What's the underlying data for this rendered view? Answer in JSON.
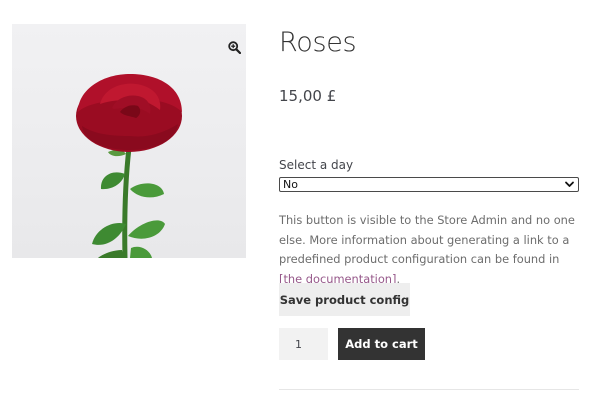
{
  "product": {
    "title": "Roses",
    "price": "15,00 £",
    "image_alt": "red rose"
  },
  "gallery": {
    "zoom_icon": "magnifier-plus-icon"
  },
  "day_select": {
    "label": "Select a day",
    "selected": "No"
  },
  "admin_notice": {
    "text_before": "This button is visible to the Store Admin and no one else. More information about generating a link to a predefined product configuration can be found in ",
    "link_text": "[the documentation]",
    "text_after": "."
  },
  "actions": {
    "save_config_label": "Save product config",
    "quantity": "1",
    "add_to_cart_label": "Add to cart"
  },
  "colors": {
    "button_dark": "#333333",
    "button_light": "#eeeeee",
    "link": "#96588a",
    "rose_red": "#b0102a",
    "leaf_green": "#3e8a32"
  }
}
